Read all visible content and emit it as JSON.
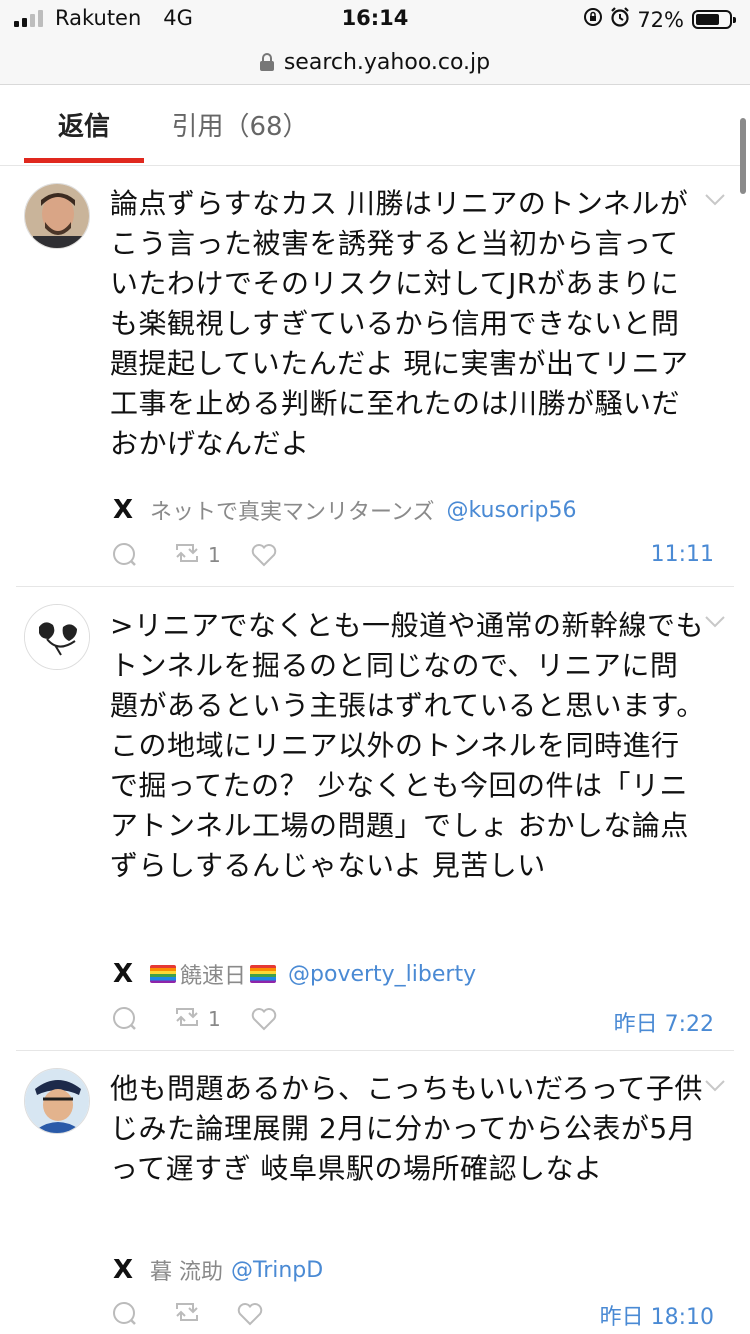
{
  "status_bar": {
    "carrier": "Rakuten",
    "network": "4G",
    "time": "16:14",
    "battery_percent": "72%",
    "battery_level": 0.72
  },
  "browser": {
    "url": "search.yahoo.co.jp"
  },
  "tabs": [
    {
      "label": "返信",
      "active": true
    },
    {
      "label": "引用（68）",
      "active": false
    }
  ],
  "posts": [
    {
      "text": "論点ずらすなカス 川勝はリニアのトンネルがこう言った被害を誘発すると当初から言っていたわけでそのリスクに対してJRがあまりにも楽観視しすぎているから信用できないと問題提起していたんだよ 現に実害が出てリニア工事を止める判断に至れたのは川勝が騒いだおかげなんだよ",
      "user_name": "ネットで真実マンリターンズ",
      "handle": "@kusorip56",
      "retweets": "1",
      "time": "11:11"
    },
    {
      "text": ">リニアでなくとも一般道や通常の新幹線でもトンネルを掘るのと同じなので、リニアに問題があるという主張はずれていると思います。 この地域にリニア以外のトンネルを同時進行で掘ってたの？ 少なくとも今回の件は「リニアトンネル工場の問題」でしょ おかしな論点ずらしするんじゃないよ 見苦しい",
      "user_name": "饒速日",
      "handle": "@poverty_liberty",
      "retweets": "1",
      "time": "昨日 7:22"
    },
    {
      "text": "他も問題あるから、こっちもいいだろって子供じみた論理展開 2月に分かってから公表が5月って遅すぎ 岐阜県駅の場所確認しなよ",
      "user_name": "暮 流助",
      "handle": "@TrinpD",
      "retweets": "",
      "time": "昨日 18:10"
    }
  ],
  "icons": {
    "x_logo": "X",
    "reply": "reply-icon",
    "retweet": "retweet-icon",
    "like": "heart-icon"
  },
  "colors": {
    "accent_tab": "#e0281e",
    "link": "#4a8ad4",
    "muted": "#8a8a8a"
  }
}
